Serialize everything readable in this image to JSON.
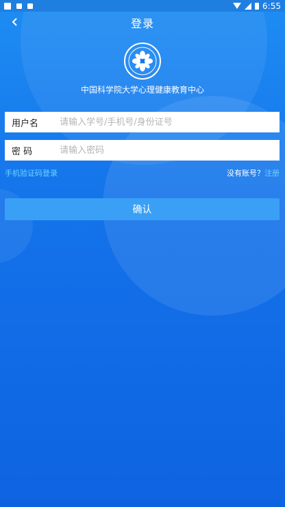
{
  "status_bar": {
    "time": "6:55"
  },
  "header": {
    "title": "登录",
    "back_icon": "back-chevron-icon"
  },
  "organization": {
    "name": "中国科学院大学心理健康教育中心"
  },
  "form": {
    "username_label": "用户名",
    "username_placeholder": "请输入学号/手机号/身份证号",
    "password_label": "密 码",
    "password_placeholder": "请输入密码"
  },
  "links": {
    "sms_login": "手机验证码登录",
    "no_account": "没有账号？",
    "register": "注册"
  },
  "confirm_label": "确认",
  "colors": {
    "background": "#1473ea",
    "accent_link": "#6fd3ff",
    "button": "#3aa0f6"
  }
}
